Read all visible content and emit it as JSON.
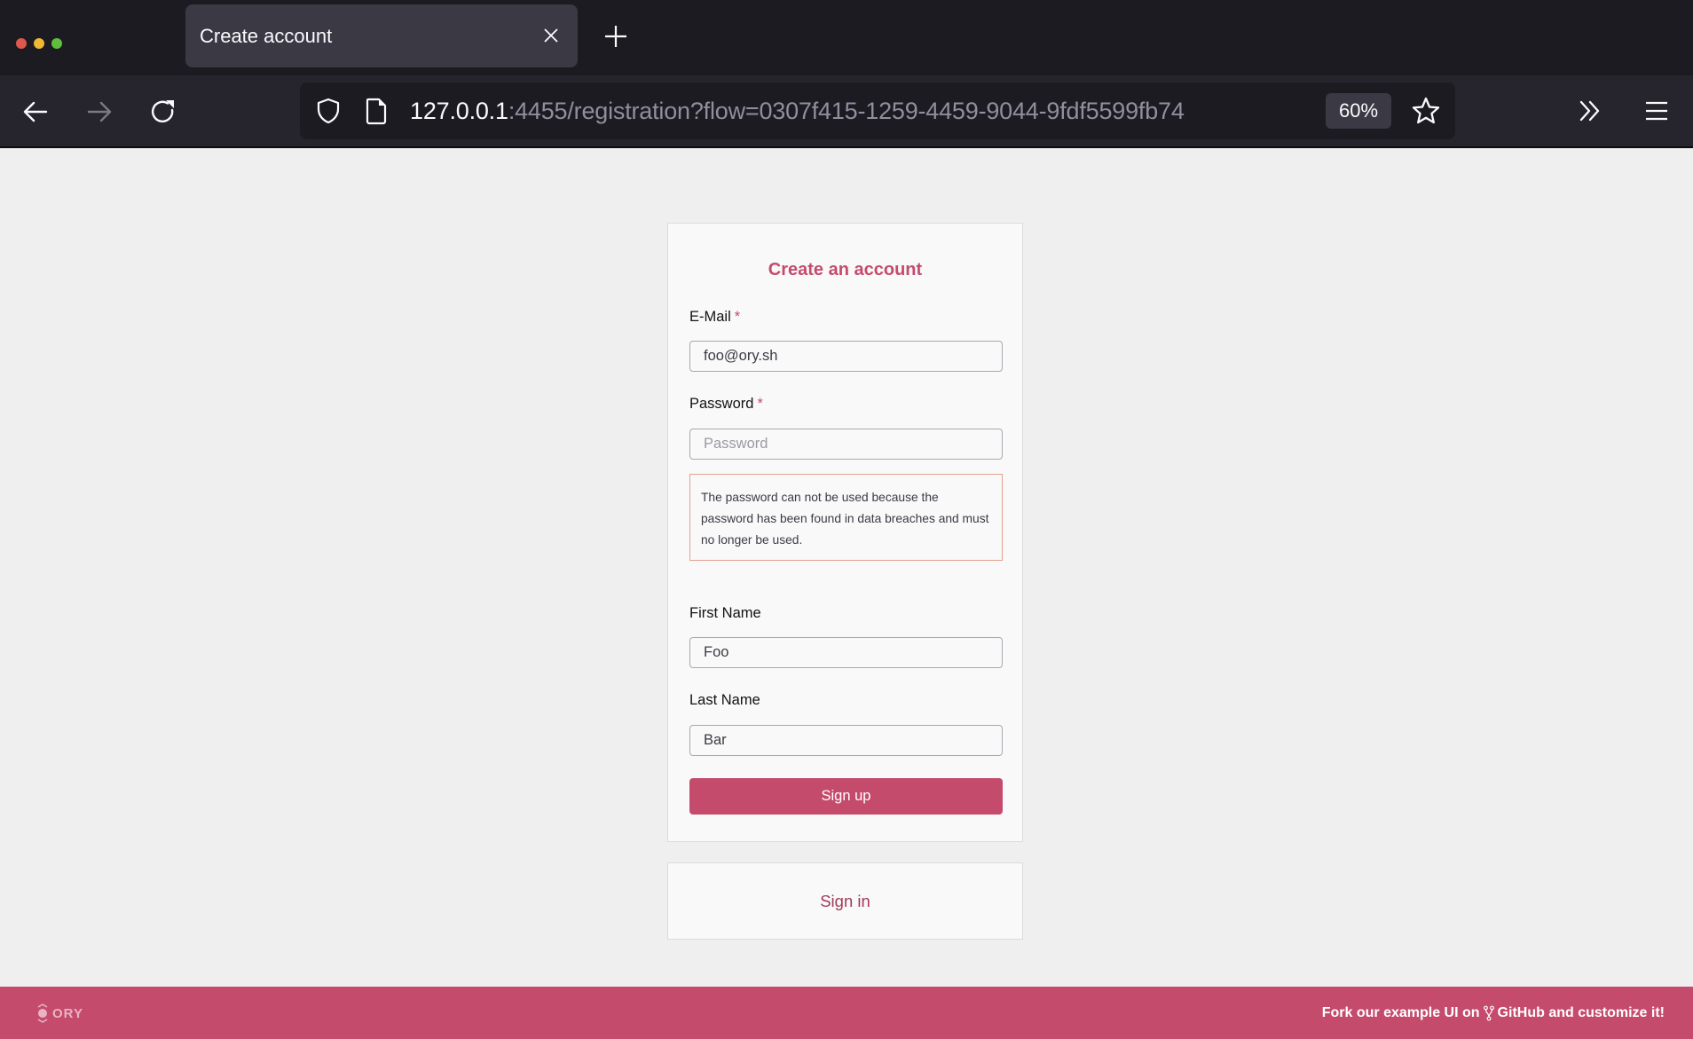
{
  "browser": {
    "tab": {
      "title": "Create account",
      "close_icon": "close-icon"
    },
    "new_tab_icon": "plus-icon",
    "nav": {
      "back_icon": "arrow-left-icon",
      "forward_icon": "arrow-right-icon",
      "reload_icon": "reload-icon"
    },
    "url": {
      "host": "127.0.0.1",
      "rest": ":4455/registration?flow=0307f415-1259-4459-9044-9fdf5599fb74",
      "shield_icon": "shield-icon",
      "page_icon": "page-icon"
    },
    "zoom_level": "60%",
    "bookmark_icon": "star-icon",
    "overflow_icon": "double-chevron-right-icon",
    "menu_icon": "hamburger-menu-icon"
  },
  "registration": {
    "title": "Create an account",
    "required_marker": "*",
    "fields": {
      "email": {
        "label": "E-Mail",
        "value": "foo@ory.sh",
        "placeholder": ""
      },
      "password": {
        "label": "Password",
        "value": "",
        "placeholder": "Password"
      },
      "first_name": {
        "label": "First Name",
        "value": "Foo",
        "placeholder": ""
      },
      "last_name": {
        "label": "Last Name",
        "value": "Bar",
        "placeholder": ""
      }
    },
    "password_error": "The password can not be used because the password has been found in data breaches and must no longer be used.",
    "submit_label": "Sign up"
  },
  "signin": {
    "label": "Sign in"
  },
  "footer": {
    "logo_text": "ORY",
    "cta_prefix": "Fork our example UI on",
    "cta_icon": "git-fork-icon",
    "cta_suffix": "GitHub and customize it!"
  },
  "colors": {
    "brand": "#c54b6d",
    "signin_link": "#a23a5a",
    "error_border": "#e3a291",
    "page_bg": "#efefef",
    "card_bg": "#f9f9f9",
    "chrome_bg": "#1c1b22",
    "toolbar_bg": "#26252e"
  }
}
